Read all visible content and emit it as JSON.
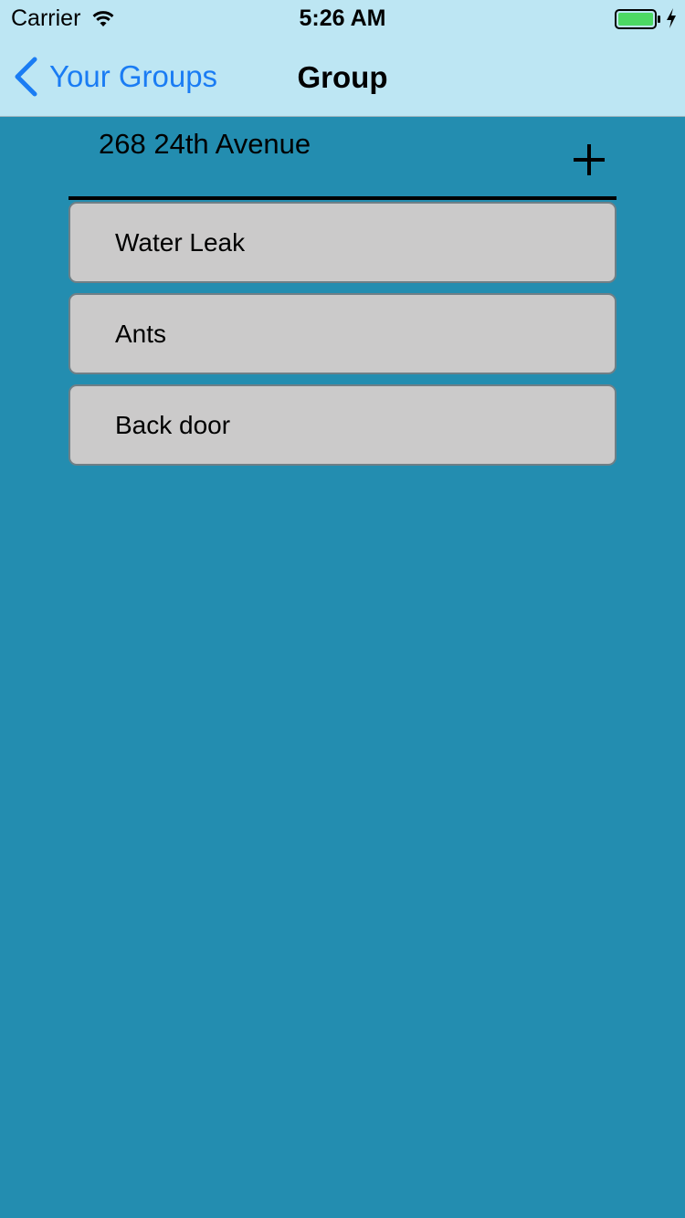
{
  "status_bar": {
    "carrier": "Carrier",
    "time": "5:26 AM",
    "battery_color": "#4cd964"
  },
  "nav": {
    "back_label": "Your Groups",
    "title": "Group",
    "accent_color": "#1a7cf3"
  },
  "group": {
    "name": "268 24th Avenue"
  },
  "issues": [
    {
      "label": "Water Leak"
    },
    {
      "label": "Ants"
    },
    {
      "label": "Back door"
    }
  ],
  "icons": {
    "wifi": "wifi-icon",
    "battery": "battery-icon",
    "charging": "charging-bolt-icon",
    "back": "chevron-left-icon",
    "add": "plus-icon"
  },
  "colors": {
    "background": "#238db0",
    "top_bar": "#bde6f3",
    "list_item": "#cbcaca"
  }
}
